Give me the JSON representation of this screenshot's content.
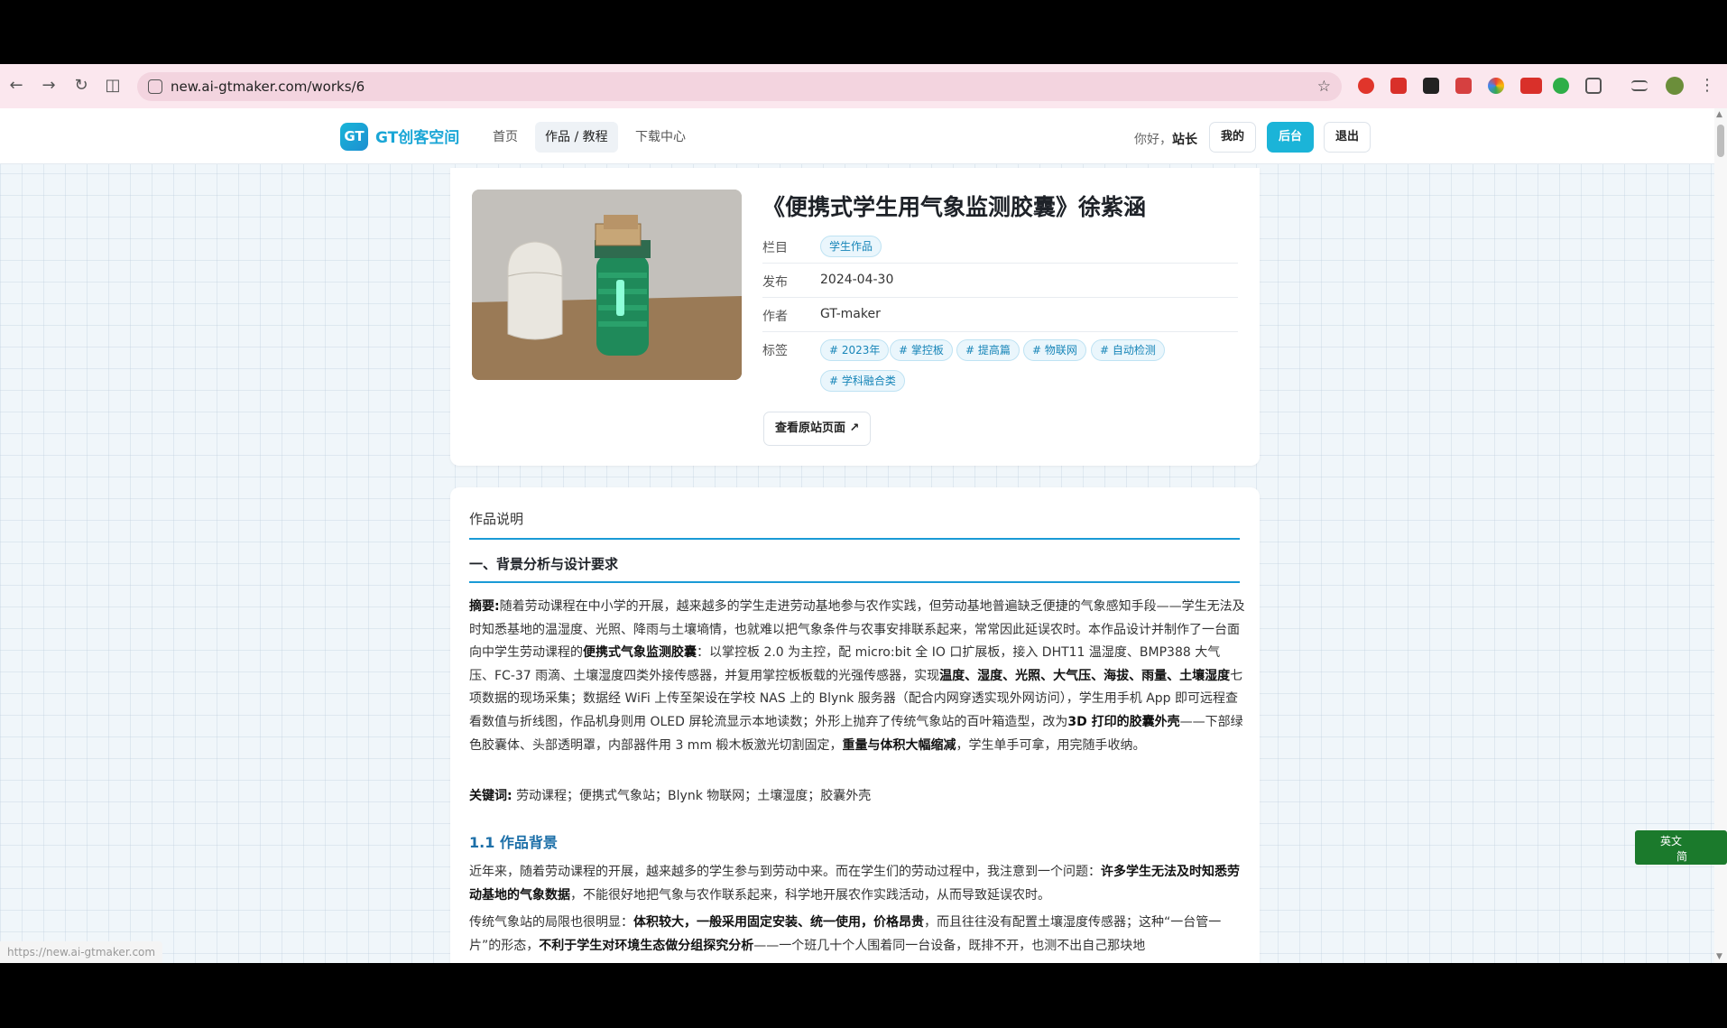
{
  "browser": {
    "url": "new.ai-gtmaker.com/works/6",
    "status_url": "https://new.ai-gtmaker.com",
    "extensions": [
      "adblock-icon",
      "pdf-icon",
      "red-ext-icon",
      "red-ext2-icon",
      "chrome-color-icon",
      "new-badge-icon",
      "green-ext-icon",
      "puzzle-icon"
    ],
    "accent": "#fbe7ee"
  },
  "site": {
    "logo_mark": "GT",
    "logo_text": "GT创客空间",
    "nav": [
      "首页",
      "作品 / 教程",
      "下载中心"
    ],
    "greeting_prefix": "你好，",
    "user_name": "站长",
    "btn_mine": "我的",
    "btn_admin": "后台",
    "btn_logout": "退出",
    "brand_color": "#1bb4d8"
  },
  "work": {
    "title": "《便携式学生用气象监测胶囊》徐紫涵",
    "label_column": "栏目",
    "column": "学生作品",
    "label_published": "发布",
    "published": "2024-04-30",
    "label_author": "作者",
    "author": "GT-maker",
    "label_tags": "标签",
    "tags": [
      "# 2023年",
      "# 掌控板",
      "# 提高篇",
      "# 物联网",
      "# 自动检测",
      "# 学科融合类"
    ],
    "original_link": "查看原站页面 ↗"
  },
  "article": {
    "section_label": "作品说明",
    "h2": "一、背景分析与设计要求",
    "abstract_label": "摘要:",
    "abstract_1": "随着劳动课程在中小学的开展，越来越多的学生走进劳动基地参与农作实践，但劳动基地普遍缺乏便捷的气象感知手段——学生无法及时知悉基地的温湿度、光照、降雨与土壤墒情，也就难以把气象条件与农事安排联系起来，常常因此延误农时。本作品设计并制作了一台面向中学生劳动课程的",
    "abstract_b1": "便携式气象监测胶囊",
    "abstract_2": "：以掌控板 2.0 为主控，配 micro:bit 全 IO 口扩展板，接入 DHT11 温湿度、BMP388 大气压、FC-37 雨滴、土壤湿度四类外接传感器，并复用掌控板板载的光强传感器，实现",
    "abstract_b2": "温度、湿度、光照、大气压、海拔、雨量、土壤湿度",
    "abstract_3": "七项数据的现场采集；数据经 WiFi 上传至架设在学校 NAS 上的 Blynk 服务器（配合内网穿透实现外网访问），学生用手机 App 即可远程查看数值与折线图，作品机身则用 OLED 屏轮流显示本地读数；外形上抛弃了传统气象站的百叶箱造型，改为",
    "abstract_b3": "3D 打印的胶囊外壳",
    "abstract_4": "——下部绿色胶囊体、头部透明罩，内部器件用 3 mm 椴木板激光切割固定，",
    "abstract_b4": "重量与体积大幅缩减",
    "abstract_5": "，学生单手可拿，用完随手收纳。",
    "keywords_label": "关键词:",
    "keywords": "劳动课程；便携式气象站；Blynk 物联网；土壤湿度；胶囊外壳",
    "h3": "1.1 作品背景",
    "p1_1": "近年来，随着劳动课程的开展，越来越多的学生参与到劳动中来。而在学生们的劳动过程中，我注意到一个问题：",
    "p1_b": "许多学生无法及时知悉劳动基地的气象数据",
    "p1_2": "，不能很好地把气象与农作联系起来，科学地开展农作实践活动，从而导致延误农时。",
    "p2_1": "传统气象站的局限也很明显：",
    "p2_b1": "体积较大，一般采用固定安装、统一使用，价格昂贵",
    "p2_2": "，而且往往没有配置土壤湿度传感器；这种“一台管一片”的形态，",
    "p2_b2": "不利于学生对环境生态做分组探究分析",
    "p2_3": "——一个班几十个人围着同一台设备，既排不开，也测不出自己那块地"
  },
  "ime": {
    "line1": "英文",
    "line2": "简"
  }
}
